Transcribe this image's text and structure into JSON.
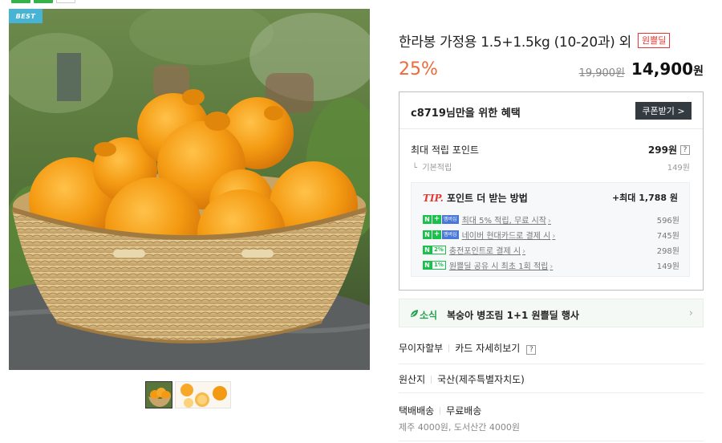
{
  "badges": {
    "best": "BEST"
  },
  "product": {
    "title": "한라봉 가정용 1.5+1.5kg (10-20과) 외",
    "title_badge": "원쁠딜",
    "discount": "25%",
    "original_price": "19,900원",
    "sale_price": "14,900",
    "sale_price_unit": "원"
  },
  "benefit": {
    "user_text": "c8719님만을 위한 혜택",
    "coupon_button": "쿠폰받기 >",
    "max_point_label": "최대 적립 포인트",
    "max_point_value": "299원",
    "help_icon_text": "?",
    "basic_label": "기본적립",
    "basic_value": "149원",
    "tip": {
      "tip_word": "TIP.",
      "title": "포인트 더 받는 방법",
      "total": "+최대 1,788 원",
      "rows": [
        {
          "badge_type": "membership",
          "pct": "",
          "text": "최대 5% 적립, 무료 시작",
          "amount": "596원"
        },
        {
          "badge_type": "membership",
          "pct": "",
          "text": "네이버 현대카드로 결제 시",
          "amount": "745원"
        },
        {
          "badge_type": "percent",
          "pct": "2%",
          "text": "충전포인트로 결제 시",
          "amount": "298원"
        },
        {
          "badge_type": "percent",
          "pct": "1%",
          "text": "원쁠딜 공유 시 최초 1회 적립",
          "amount": "149원"
        }
      ],
      "membership_label": "멤버십"
    }
  },
  "notice": {
    "label": "소식",
    "text": "복숭아 병조림 1+1 원쁠딜 행사",
    "arrow": "›"
  },
  "info": {
    "card_key": "무이자할부",
    "card_val": "카드 자세히보기",
    "card_help": "?",
    "origin_key": "원산지",
    "origin_val": "국산(제주특별자치도)",
    "ship_key": "택배배송",
    "ship_val": "무료배송",
    "ship_sub": "제주 4000원, 도서산간 4000원"
  },
  "colors": {
    "accent_green": "#19c04a",
    "discount_orange": "#ef6a3a",
    "badge_red": "#e53935",
    "best_blue": "#47b4d6"
  }
}
